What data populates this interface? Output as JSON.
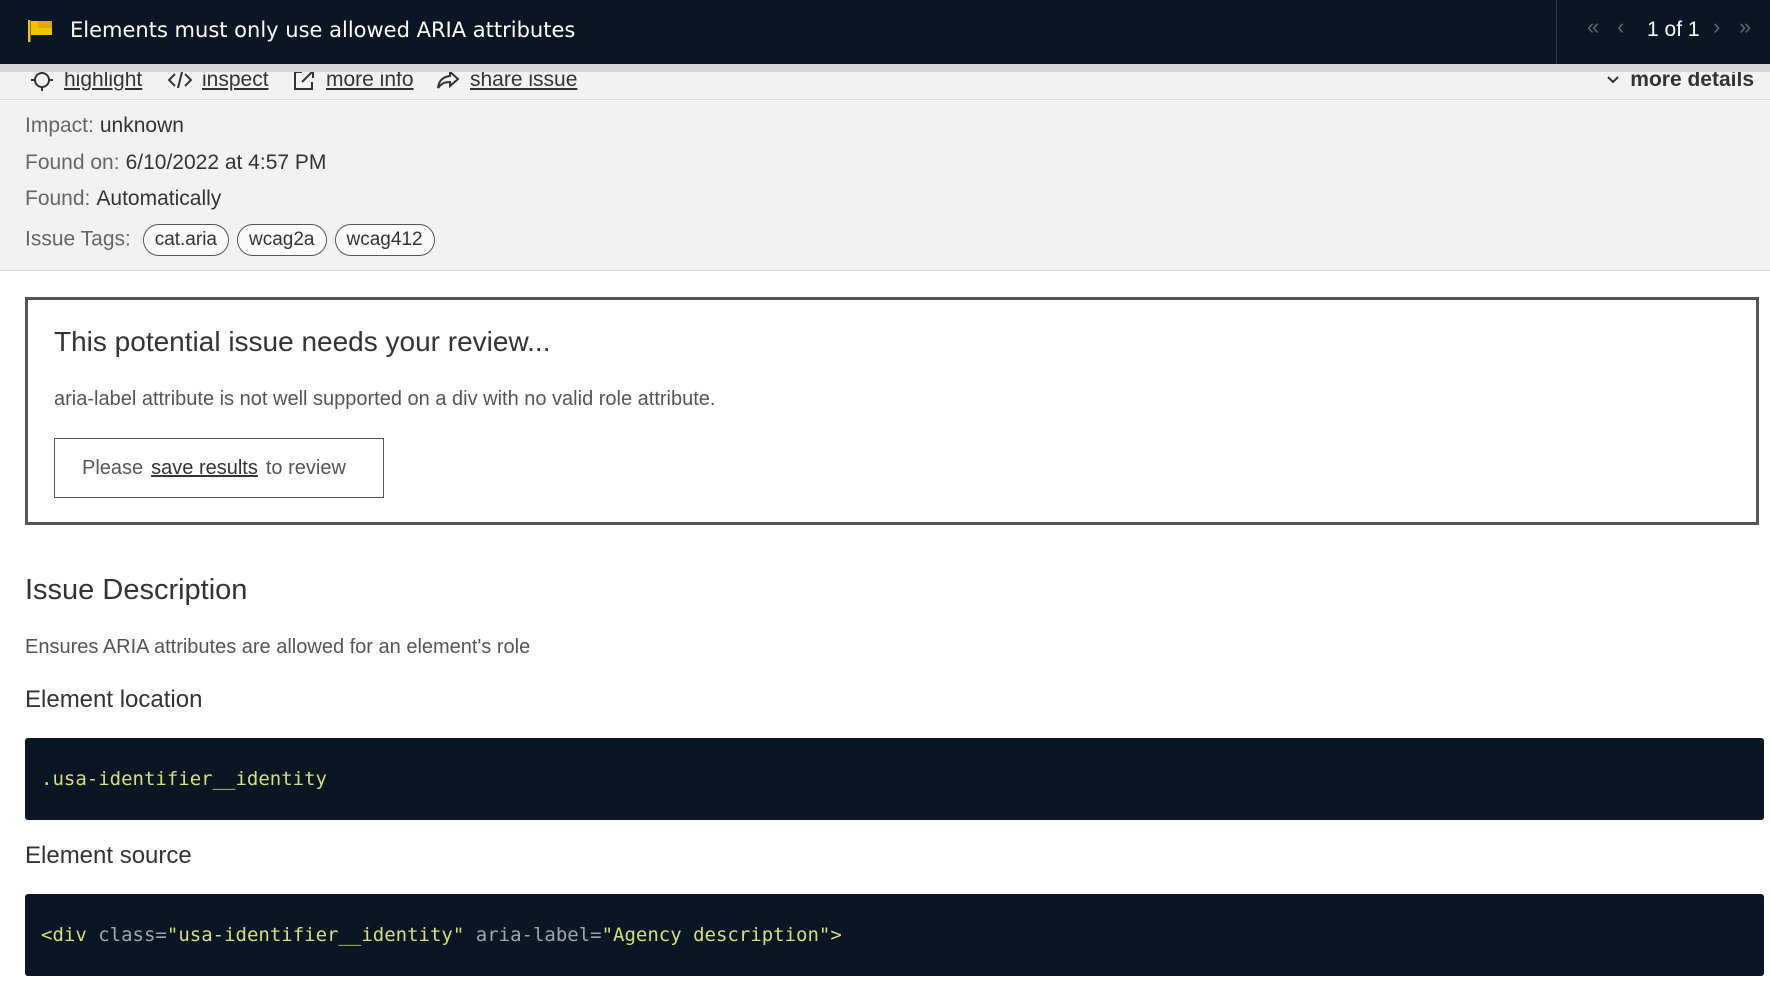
{
  "header": {
    "title": "Elements must only use allowed ARIA attributes",
    "pager": {
      "count": "1 of 1"
    },
    "accent_color": "#f2c400"
  },
  "toolbar": {
    "highlight": "highlight",
    "inspect": "inspect",
    "more_info": "more info",
    "share_issue": "share issue",
    "more_details": "more details"
  },
  "meta": {
    "impact_label": "Impact:",
    "impact_value": "unknown",
    "found_on_label": "Found on:",
    "found_on_value": "6/10/2022 at 4:57 PM",
    "found_label": "Found:",
    "found_value": "Automatically",
    "tags_label": "Issue Tags:",
    "tags": [
      "cat.aria",
      "wcag2a",
      "wcag412"
    ]
  },
  "review": {
    "title": "This potential issue needs your review...",
    "text": "aria-label attribute is not well supported on a div with no valid role attribute.",
    "save_prefix": "Please",
    "save_link": "save results",
    "save_suffix": "to review"
  },
  "issue": {
    "heading": "Issue Description",
    "description": "Ensures ARIA attributes are allowed for an element's role",
    "location_heading": "Element location",
    "location_code": ".usa-identifier__identity",
    "source_heading": "Element source",
    "source": {
      "open": "<div",
      "attr1": "class",
      "val1": "\"usa-identifier__identity\"",
      "attr2": "aria-label",
      "val2": "\"Agency description\"",
      "close": ">"
    }
  }
}
